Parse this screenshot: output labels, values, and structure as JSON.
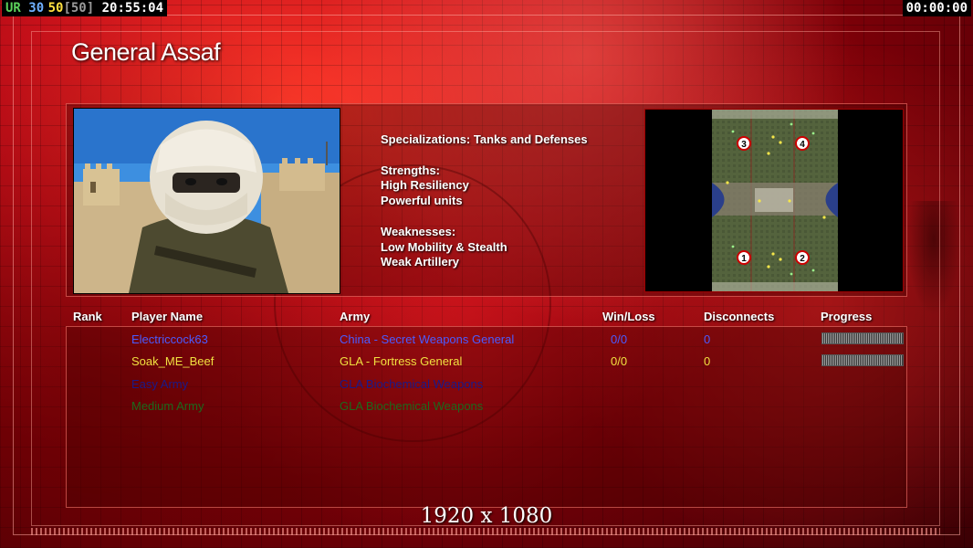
{
  "hud": {
    "ur_label": "UR",
    "num1": "30",
    "num2": "50",
    "num3": "[50]",
    "clock": "20:55:04",
    "timer": "00:00:00"
  },
  "general": {
    "name": "General Assaf",
    "specializations": "Specializations: Tanks and Defenses",
    "strengths_heading": "Strengths:",
    "strengths": [
      "High Resiliency",
      "Powerful units"
    ],
    "weaknesses_heading": "Weaknesses:",
    "weaknesses": [
      "Low Mobility & Stealth",
      "Weak Artillery"
    ]
  },
  "map": {
    "start_positions": [
      "3",
      "4",
      "1",
      "2"
    ]
  },
  "table": {
    "headers": {
      "rank": "Rank",
      "player": "Player Name",
      "army": "Army",
      "winloss": "Win/Loss",
      "disconnects": "Disconnects",
      "progress": "Progress"
    },
    "rows": [
      {
        "player": "Electriccock63",
        "army": "China - Secret Weapons General",
        "winloss": "0/0",
        "disconnects": "0",
        "progress": 1.0,
        "color": "#4a5cff"
      },
      {
        "player": "Soak_ME_Beef",
        "army": "GLA - Fortress General",
        "winloss": "0/0",
        "disconnects": "0",
        "progress": 1.0,
        "color": "#f0e040"
      },
      {
        "player": "Easy Army",
        "army": "GLA Biochemical Weapons",
        "winloss": "",
        "disconnects": "",
        "color": "#1a1a8a"
      },
      {
        "player": "Medium Army",
        "army": "GLA Biochemical Weapons",
        "winloss": "",
        "disconnects": "",
        "color": "#1c6a1c"
      }
    ]
  },
  "footer": {
    "resolution": "1920 x 1080"
  },
  "colors": {
    "hud_ur": "#5bd15b",
    "hud_num1": "#6fb0ff",
    "hud_num2": "#ffe040",
    "hud_num3": "#9a9a9a",
    "accent_red": "#c8101a"
  }
}
